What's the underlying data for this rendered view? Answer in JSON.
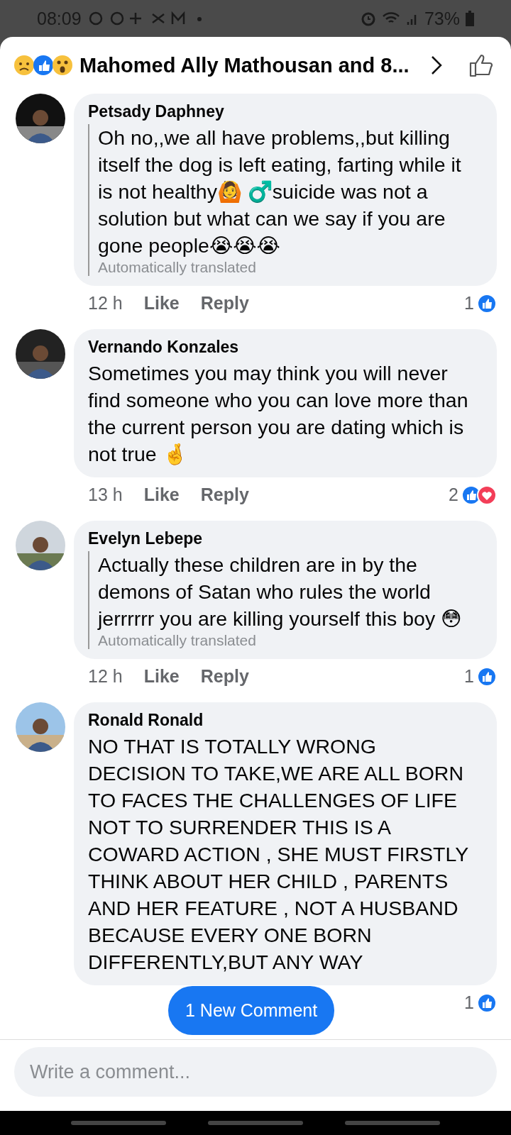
{
  "status_bar": {
    "time": "08:09",
    "battery": "73%"
  },
  "header": {
    "title": "Mahomed Ally Mathousan and 8..."
  },
  "comments": [
    {
      "author": "Petsady Daphney",
      "text": "Oh no,,we all have problems,,but killing itself the dog is left eating, farting while it is not healthy🙆 ♂️suicide was not a solution but what can we say if you are gone people😭😭😭",
      "translated": true,
      "note": "Automatically translated",
      "time": "12 h",
      "like": "Like",
      "reply": "Reply",
      "count": "1",
      "reactions": [
        {
          "kind": "like"
        }
      ]
    },
    {
      "author": "Vernando Konzales",
      "text": "Sometimes you may  think you will never find someone who you can love more than the current person you are dating which is not true 🤞",
      "translated": false,
      "time": "13 h",
      "like": "Like",
      "reply": "Reply",
      "count": "2",
      "reactions": [
        {
          "kind": "like"
        },
        {
          "kind": "love"
        }
      ]
    },
    {
      "author": "Evelyn Lebepe",
      "text": "Actually these children are in by the demons of Satan who rules the world jerrrrrr you are killing yourself this boy 😳",
      "translated": true,
      "note": "Automatically translated",
      "time": "12 h",
      "like": "Like",
      "reply": "Reply",
      "count": "1",
      "reactions": [
        {
          "kind": "like"
        }
      ]
    },
    {
      "author": "Ronald Ronald",
      "text": "NO THAT IS TOTALLY WRONG DECISION TO  TAKE,WE ARE ALL BORN TO FACES THE CHALLENGES OF LIFE NOT TO SURRENDER THIS IS A COWARD ACTION , SHE MUST FIRSTLY THINK ABOUT HER CHILD , PARENTS AND HER FEATURE , NOT A HUSBAND BECAUSE EVERY ONE BORN DIFFERENTLY,BUT ANY WAY",
      "translated": false,
      "count": "1",
      "reactions": [
        {
          "kind": "like"
        }
      ]
    }
  ],
  "new_comments_button": "1 New Comment",
  "composer": {
    "placeholder": "Write a comment..."
  }
}
